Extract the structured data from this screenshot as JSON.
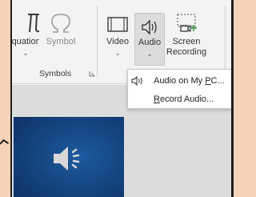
{
  "ribbon": {
    "equation": {
      "label": "Equation",
      "has_dropdown": true
    },
    "symbol": {
      "label": "Symbol"
    },
    "symbols_group_label": "Symbols",
    "video": {
      "label": "Video",
      "has_dropdown": true
    },
    "audio": {
      "label": "Audio",
      "has_dropdown": true,
      "selected": true
    },
    "screen_recording": {
      "label_line1": "Screen",
      "label_line2": "Recording"
    },
    "chevron": "⌄"
  },
  "audio_menu": {
    "items": [
      {
        "label_prefix": "Audio on My ",
        "label_accel": "P",
        "label_suffix": "C...",
        "icon": "speaker-icon"
      },
      {
        "label_prefix": "",
        "label_accel": "R",
        "label_suffix": "ecord Audio...",
        "icon": ""
      }
    ]
  },
  "slide": {
    "icon": "speaker-icon"
  },
  "colors": {
    "background_peach": "#f6d2b8",
    "ribbon": "#f3f3f3",
    "slide_blue": "#154682",
    "selected_button": "#dcdcdc"
  }
}
